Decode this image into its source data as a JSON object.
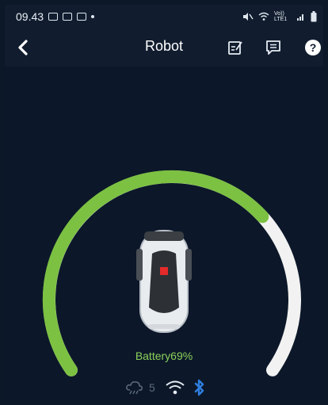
{
  "status_bar": {
    "time": "09.43",
    "right_text": "Vo)) LTE1"
  },
  "header": {
    "title": "Robot",
    "icons": [
      "back-chevron",
      "edit-note-icon",
      "message-icon",
      "help-icon"
    ]
  },
  "gauge": {
    "battery_percent": 69,
    "battery_label": "Battery69%",
    "colors": {
      "filled": "#7cc142",
      "empty": "#f2f2f2",
      "background": "#0c1829"
    }
  },
  "connectivity": {
    "rain_count": "5",
    "icons": [
      "rain-cloud-icon",
      "wifi-icon",
      "bluetooth-icon"
    ],
    "bluetooth_color": "#2f7fe0"
  }
}
